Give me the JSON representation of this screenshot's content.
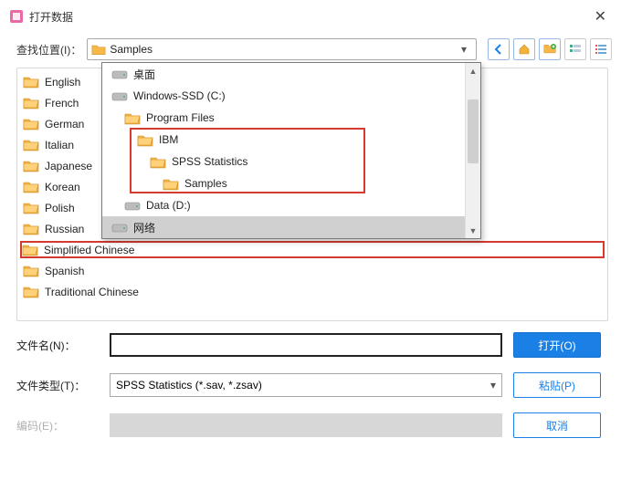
{
  "title": "打开数据",
  "labels": {
    "look_in": "查找位置(I)：",
    "filename": "文件名(N)：",
    "filetype": "文件类型(T)：",
    "encoding": "编码(E)："
  },
  "location": {
    "selected": "Samples"
  },
  "dropdown": {
    "items": [
      {
        "label": "桌面",
        "depth": 0,
        "type": "desktop"
      },
      {
        "label": "Windows-SSD (C:)",
        "depth": 0,
        "type": "drive"
      },
      {
        "label": "Program Files",
        "depth": 1,
        "type": "folder"
      },
      {
        "label": "IBM",
        "depth": 2,
        "type": "folder"
      },
      {
        "label": "SPSS Statistics",
        "depth": 3,
        "type": "folder"
      },
      {
        "label": "Samples",
        "depth": 4,
        "type": "folder"
      },
      {
        "label": "Data (D:)",
        "depth": 1,
        "type": "drive"
      },
      {
        "label": "网络",
        "depth": 0,
        "type": "network",
        "selected": true
      }
    ],
    "highlight_start": 3,
    "highlight_end": 5
  },
  "folders": [
    "English",
    "French",
    "German",
    "Italian",
    "Japanese",
    "Korean",
    "Polish",
    "Russian",
    "Simplified Chinese",
    "Spanish",
    "Traditional Chinese"
  ],
  "highlighted_folder": "Simplified Chinese",
  "filename_value": "",
  "filetype_value": "SPSS Statistics (*.sav, *.zsav)",
  "buttons": {
    "open": "打开(O)",
    "paste": "粘贴(P)",
    "cancel": "取消"
  },
  "colors": {
    "accent": "#1a80e6",
    "highlight_border": "#d43a2e",
    "folder_fill": "#f7b84a"
  },
  "toolbar_icons": [
    "back-icon",
    "home-icon",
    "new-folder-icon",
    "list-view-icon",
    "detail-view-icon"
  ]
}
